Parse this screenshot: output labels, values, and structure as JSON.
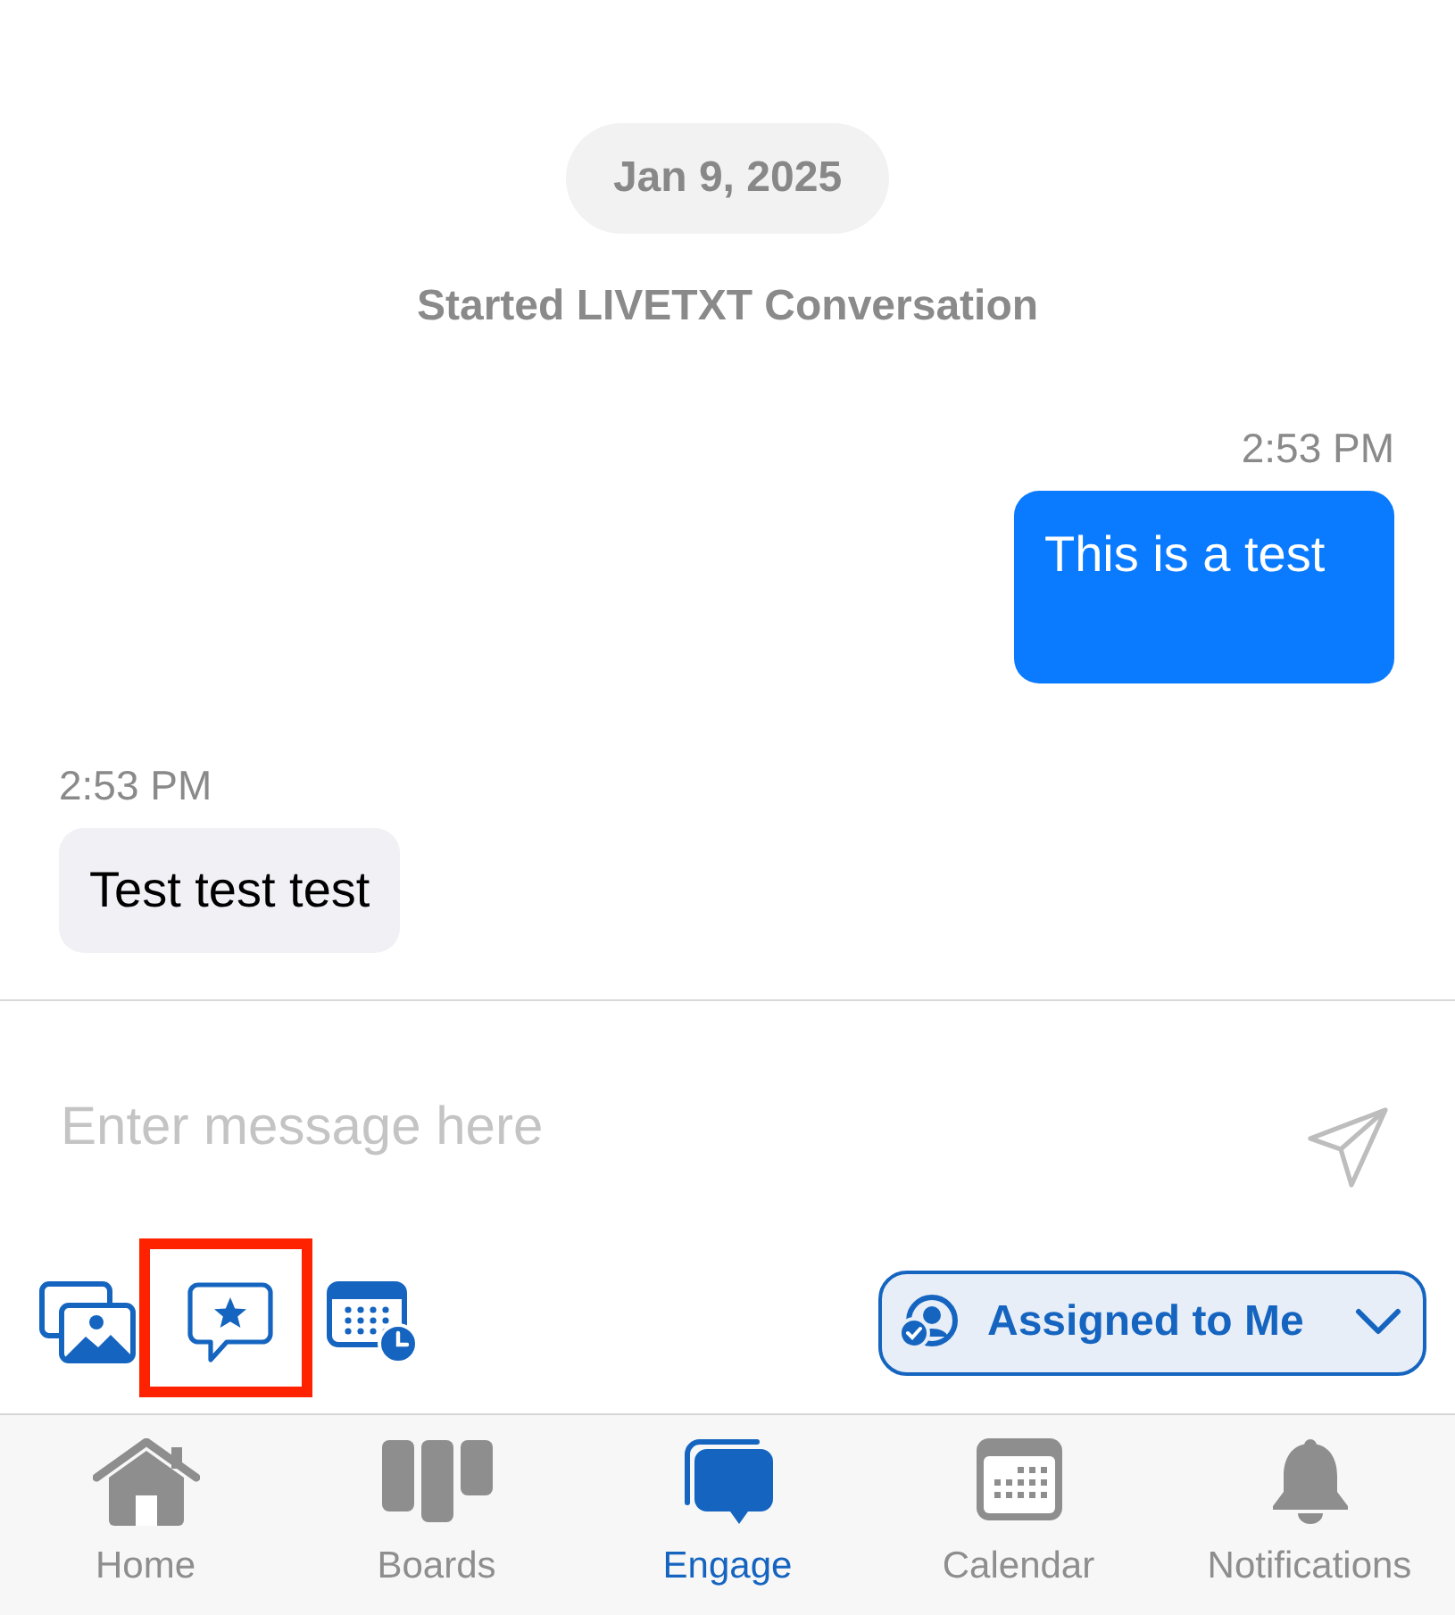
{
  "conversation": {
    "date": "Jan 9, 2025",
    "event": "Started LIVETXT Conversation",
    "messages": [
      {
        "kind": "outgoing",
        "time": "2:53 PM",
        "text": "This is a test"
      },
      {
        "kind": "incoming",
        "time": "2:53 PM",
        "text": "Test test test"
      }
    ]
  },
  "composer": {
    "placeholder": "Enter message here"
  },
  "toolbar": {
    "tools": [
      {
        "kind": "gallery",
        "highlighted": false
      },
      {
        "kind": "quick-reply",
        "highlighted": true
      },
      {
        "kind": "schedule",
        "highlighted": false
      }
    ],
    "filter": {
      "label": "Assigned to Me"
    }
  },
  "tab_bar": {
    "tabs": [
      {
        "kind": "home",
        "label": "Home",
        "selected": false
      },
      {
        "kind": "boards",
        "label": "Boards",
        "selected": false
      },
      {
        "kind": "engage",
        "label": "Engage",
        "selected": true
      },
      {
        "kind": "calendar",
        "label": "Calendar",
        "selected": false
      },
      {
        "kind": "notifications",
        "label": "Notifications",
        "selected": false
      }
    ]
  }
}
